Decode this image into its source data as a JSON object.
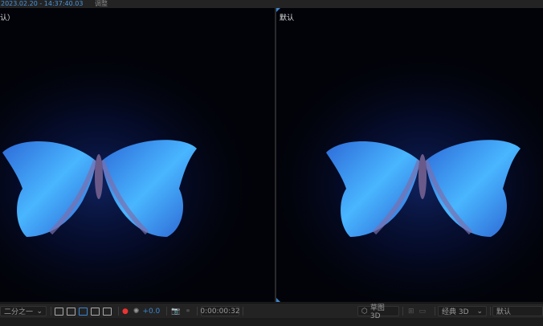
{
  "header": {
    "timestamp": "2023.02.20 - 14:37:40.03",
    "tab": "调整"
  },
  "viewers": [
    {
      "label": "认）"
    },
    {
      "label": "默认"
    }
  ],
  "toolbar": {
    "magnification": "二分之一",
    "exposure": "+0.0",
    "timecode": "0:00:00:32",
    "renderer": "草图 3D",
    "mode": "经典 3D",
    "view": "默认"
  },
  "colors": {
    "accent": "#3a86d0",
    "background": "#020309",
    "wing": "#3aa8ff"
  }
}
